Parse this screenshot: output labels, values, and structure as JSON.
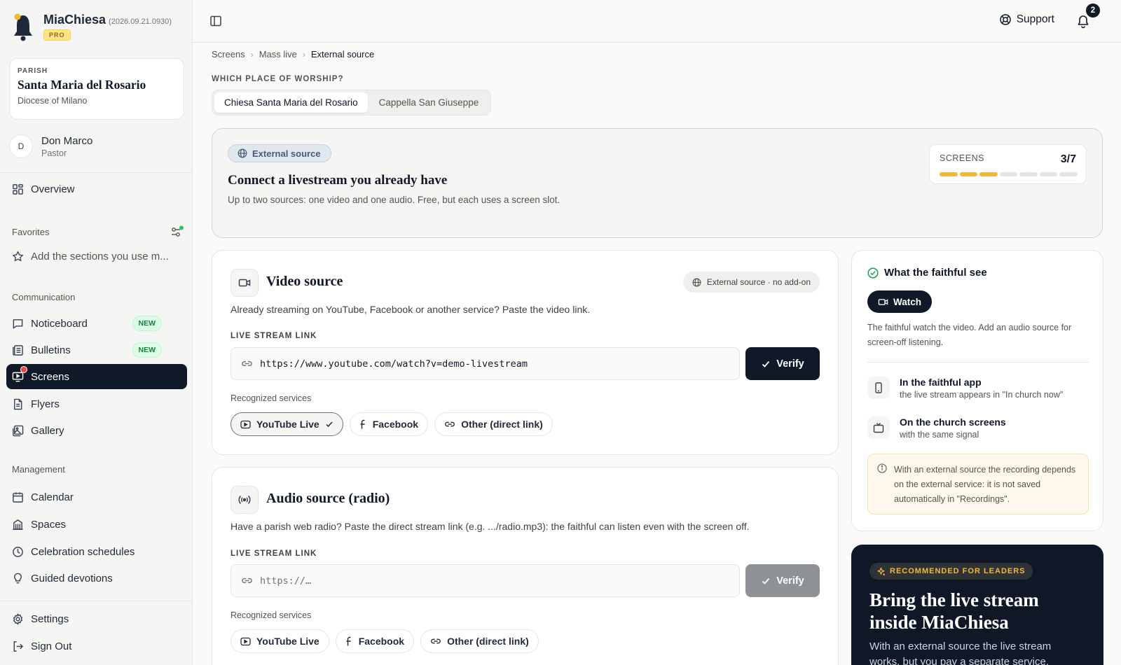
{
  "app": {
    "name": "MiaChiesa",
    "version": "(2026.09.21.0930)",
    "plan_badge": "PRO"
  },
  "parish": {
    "label": "PARISH",
    "name": "Santa Maria del Rosario",
    "diocese": "Diocese of Milano"
  },
  "user": {
    "initial": "D",
    "name": "Don Marco",
    "role": "Pastor"
  },
  "sidebar": {
    "overview": "Overview",
    "favorites_label": "Favorites",
    "favorites_add": "Add the sections you use m...",
    "communication_label": "Communication",
    "communication": [
      {
        "label": "Noticeboard",
        "badge": "NEW"
      },
      {
        "label": "Bulletins",
        "badge": "NEW"
      },
      {
        "label": "Screens"
      },
      {
        "label": "Flyers"
      },
      {
        "label": "Gallery"
      }
    ],
    "management_label": "Management",
    "management": [
      {
        "label": "Calendar"
      },
      {
        "label": "Spaces"
      },
      {
        "label": "Celebration schedules"
      },
      {
        "label": "Guided devotions"
      }
    ],
    "settings": "Settings",
    "sign_out": "Sign Out",
    "active_item": "Screens"
  },
  "topbar": {
    "support": "Support",
    "notifications_count": "2"
  },
  "breadcrumb": [
    "Screens",
    "Mass live",
    "External source"
  ],
  "worship": {
    "label": "WHICH PLACE OF WORSHIP?",
    "options": [
      "Chiesa Santa Maria del Rosario",
      "Cappella San Giuseppe"
    ],
    "selected": "Chiesa Santa Maria del Rosario"
  },
  "hero": {
    "badge": "External source",
    "title": "Connect a livestream you already have",
    "description": "Up to two sources: one video and one audio. Free, but each uses a screen slot.",
    "screens_label": "SCREENS",
    "screens_value": "3/7",
    "screens_used": 3,
    "screens_total": 7
  },
  "video": {
    "title": "Video source",
    "badge": "External source · no add-on",
    "description": "Already streaming on YouTube, Facebook or another service? Paste the video link.",
    "field_label": "LIVE STREAM LINK",
    "value": "https://www.youtube.com/watch?v=demo-livestream",
    "verify": "Verify",
    "recognized_label": "Recognized services",
    "services": [
      "YouTube Live",
      "Facebook",
      "Other (direct link)"
    ],
    "selected_service": "YouTube Live"
  },
  "audio": {
    "title": "Audio source (radio)",
    "description": "Have a parish web radio? Paste the direct stream link (e.g. .../radio.mp3): the faithful can listen even with the screen off.",
    "field_label": "LIVE STREAM LINK",
    "placeholder": "https://…",
    "verify": "Verify",
    "recognized_label": "Recognized services",
    "services": [
      "YouTube Live",
      "Facebook",
      "Other (direct link)"
    ]
  },
  "faithful": {
    "title": "What the faithful see",
    "watch": "Watch",
    "description": "The faithful watch the video. Add an audio source for screen-off listening.",
    "rows": [
      {
        "title": "In the faithful app",
        "subtitle": "the live stream appears in \"In church now\""
      },
      {
        "title": "On the church screens",
        "subtitle": "with the same signal"
      }
    ],
    "note": "With an external source the recording depends on the external service: it is not saved automatically in \"Recordings\"."
  },
  "promo": {
    "badge": "RECOMMENDED FOR LEADERS",
    "title": "Bring the live stream inside MiaChiesa",
    "description": "With an external source the live stream works, but you pay a separate service."
  },
  "colors": {
    "accent_dark": "#111827",
    "progress_on": "#f2b83b",
    "new_badge": "#15803d",
    "notification_dot": "#ef4444"
  }
}
